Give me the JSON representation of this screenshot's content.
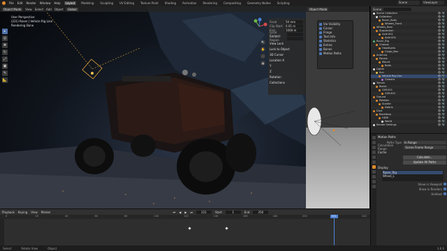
{
  "topbar": {
    "menus": [
      "File",
      "Edit",
      "Render",
      "Window",
      "Help"
    ],
    "tabs": [
      "Layout",
      "Modeling",
      "Sculpting",
      "UV Editing",
      "Texture Paint",
      "Shading",
      "Animation",
      "Rendering",
      "Compositing",
      "Geometry Nodes",
      "Scripting"
    ],
    "active_tab": "Layout",
    "scene_label": "Scene",
    "view_layer_label": "ViewLayer"
  },
  "viewport": {
    "mode": "Object Mode",
    "menus": [
      "View",
      "Select",
      "Add",
      "Object"
    ],
    "transform": "Global",
    "overlay_lines": [
      "User Perspective",
      "(221) Rover | Vehicle Rig Line",
      "Rendering Done"
    ],
    "tools": [
      "▸",
      "◎",
      "✥",
      "↻",
      "⤢",
      "▣",
      "✎",
      "📐"
    ],
    "nav_buttons": [
      "🔍",
      "✋",
      "🎥",
      "▦"
    ],
    "npanel": {
      "rows": [
        {
          "label": "Focal",
          "value": "50 mm"
        },
        {
          "label": "Clip Start",
          "value": "0.01 m"
        },
        {
          "label": "End",
          "value": "1000 m"
        },
        {
          "label": "Local Camera",
          "value": ""
        },
        {
          "label": "Render Region",
          "value": ""
        }
      ],
      "sections": [
        "View Lock",
        "Lock to Object",
        "3D Cursor",
        "Location X",
        "Y",
        "Z",
        "Rotation",
        "Collections"
      ]
    }
  },
  "viewport2": {
    "mode": "Object Mode",
    "popup_items": [
      "Vie Visibility",
      "Cursor",
      "Fringe",
      "Text Info",
      "Statistics",
      "Extras",
      "Bones",
      "Motion Paths"
    ]
  },
  "outliner": {
    "search_placeholder": "",
    "header_label": "Scene",
    "rows": [
      {
        "name": "Scene Collection",
        "color": "#e0e0e0",
        "sel": false
      },
      {
        "name": "Collection",
        "color": "#e0e0e0",
        "sel": false
      },
      {
        "name": "Rover_Body",
        "color": "#e08a2c",
        "sel": false
      },
      {
        "name": "Wheels_Front",
        "color": "#e08a2c",
        "sel": false
      },
      {
        "name": "Wheels_Rear",
        "color": "#e08a2c",
        "sel": false
      },
      {
        "name": "Suspension",
        "color": "#e08a2c",
        "sel": false
      },
      {
        "name": "Axle.001",
        "color": "#e08a2c",
        "sel": false
      },
      {
        "name": "Axle.002",
        "color": "#e08a2c",
        "sel": false
      },
      {
        "name": "Rover_Rig",
        "color": "#4eb86e",
        "sel": false
      },
      {
        "name": "Chassis",
        "color": "#e08a2c",
        "sel": false
      },
      {
        "name": "Headlights",
        "color": "#e08a2c",
        "sel": false
      },
      {
        "name": "Cargo_Box",
        "color": "#e08a2c",
        "sel": false
      },
      {
        "name": "Antenna",
        "color": "#e08a2c",
        "sel": false
      },
      {
        "name": "Panels",
        "color": "#e08a2c",
        "sel": false
      },
      {
        "name": "Mount",
        "color": "#e08a2c",
        "sel": false
      },
      {
        "name": "Bolts",
        "color": "#e08a2c",
        "sel": false
      },
      {
        "name": "Lights",
        "color": "#e0e0e0",
        "sel": false
      },
      {
        "name": "Sun",
        "color": "#e6c84a",
        "sel": false
      },
      {
        "name": "Vehicle Rig Line",
        "color": "#e08a2c",
        "sel": true
      },
      {
        "name": "Camera",
        "color": "#b06ad6",
        "sel": false
      },
      {
        "name": "Terrain",
        "color": "#e0e0e0",
        "sel": false
      },
      {
        "name": "Rocks",
        "color": "#e08a2c",
        "sel": false
      },
      {
        "name": "Cliff.001",
        "color": "#e08a2c",
        "sel": false
      },
      {
        "name": "Cliff.002",
        "color": "#e08a2c",
        "sel": false
      },
      {
        "name": "Ground",
        "color": "#e08a2c",
        "sel": false
      },
      {
        "name": "Pebbles",
        "color": "#e08a2c",
        "sel": false
      },
      {
        "name": "Scatter",
        "color": "#e08a2c",
        "sel": false
      },
      {
        "name": "Debris",
        "color": "#e08a2c",
        "sel": false
      },
      {
        "name": "Dust",
        "color": "#e08a2c",
        "sel": false
      },
      {
        "name": "Backdrop",
        "color": "#e08a2c",
        "sel": false
      },
      {
        "name": "HDRI",
        "color": "#e08a2c",
        "sel": false
      },
      {
        "name": "World",
        "color": "#e0e0e0",
        "sel": false
      },
      {
        "name": "Render Settings",
        "color": "#e0e0e0",
        "sel": false
      }
    ]
  },
  "properties": {
    "head": "Motion Paths",
    "rows": [
      {
        "label": "Paths Type",
        "value": "In Range"
      },
      {
        "label": "Calculation Range",
        "value": "Scene Frame Range"
      }
    ],
    "sections": [
      "Cache",
      "Display"
    ],
    "buttons": [
      "Calculate...",
      "Update All Paths"
    ],
    "list_items": [
      "Rover_Rig",
      "Wheel_L"
    ],
    "list_selected": 0,
    "checkboxes": [
      {
        "label": "Show in Viewport"
      },
      {
        "label": "Show in Renders"
      },
      {
        "label": "Holdout"
      }
    ]
  },
  "timeline": {
    "menus": [
      "Playback",
      "Keying",
      "View",
      "Marker"
    ],
    "current_frame": "221",
    "start_label": "Start",
    "start": "1",
    "end_label": "End",
    "end": "250",
    "ticks": [
      "0",
      "20",
      "40",
      "60",
      "80",
      "100",
      "120",
      "140",
      "160",
      "180",
      "200",
      "220",
      "240"
    ],
    "keys_frac": [
      0.51,
      0.61
    ]
  },
  "statusbar": {
    "items": [
      "Select",
      "Rotate View",
      "Object"
    ],
    "version": "3.6.0"
  }
}
